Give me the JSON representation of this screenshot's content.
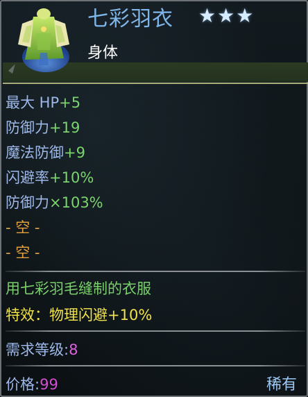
{
  "item": {
    "name": "七彩羽衣",
    "stars": "★★★",
    "slot": "身体"
  },
  "stats": [
    {
      "label": "最大 HP",
      "value": "+5"
    },
    {
      "label": "防御力",
      "value": "+19"
    },
    {
      "label": "魔法防御",
      "value": "+9"
    },
    {
      "label": "闪避率",
      "value": "+10%"
    },
    {
      "label": "防御力",
      "value": "×103%"
    }
  ],
  "empty_slots": [
    "- 空 -",
    "- 空 -"
  ],
  "description": "用七彩羽毛缝制的衣服",
  "effect": "特效：物理闪避+10%",
  "requirement": {
    "label": "需求等级:",
    "value": "8"
  },
  "price": {
    "label": "价格:",
    "value": "99"
  },
  "rarity": "稀有",
  "icons": {
    "item_icon": "feather-robe-icon",
    "star_icon": "star-icon"
  },
  "colors": {
    "name": "#7fb6ea",
    "stat_label": "#9db8e8",
    "stat_value": "#7cd46e",
    "empty_slot": "#e0a040",
    "description": "#79d06a",
    "effect": "#f0e14a",
    "level_value": "#e060e0",
    "price_value": "#d24ed0",
    "rarity": "#9ec8f4"
  }
}
